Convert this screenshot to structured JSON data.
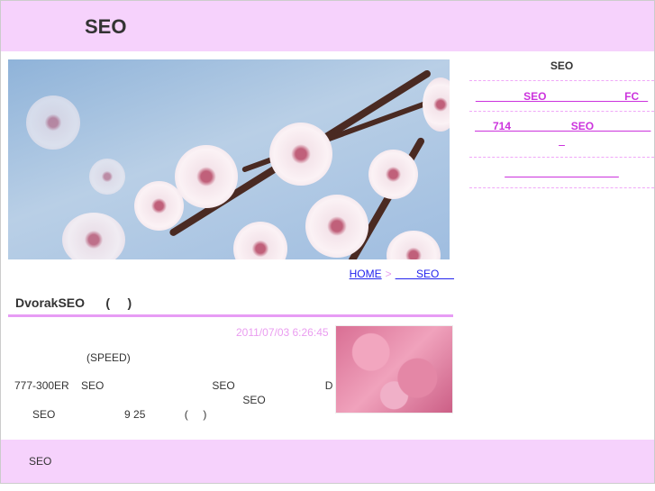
{
  "header": {
    "site_title": "SEO"
  },
  "breadcrumb": {
    "home": "HOME",
    "separator": ">",
    "current": "       SEO     "
  },
  "post": {
    "title": "DvorakSEO      (     )",
    "date": "2011/07/03 6:26:45",
    "lines": [
      "                        (SPEED)",
      "777-300ER    SEO                                    SEO                              D",
      "                                                                            SEO",
      "      SEO                       9 25             (     )"
    ]
  },
  "sidebar": {
    "title": "SEO",
    "items": [
      {
        "label": "                SEO                          FC   "
      },
      {
        "label": "      714                    SEO                   \n_"
      },
      {
        "label": "                                      "
      }
    ]
  },
  "footer": {
    "text": "SEO"
  },
  "colors": {
    "header_bg": "#f6d2fc",
    "accent": "#e79cf5",
    "link": "#2222ee",
    "side_link": "#cc33dd"
  }
}
